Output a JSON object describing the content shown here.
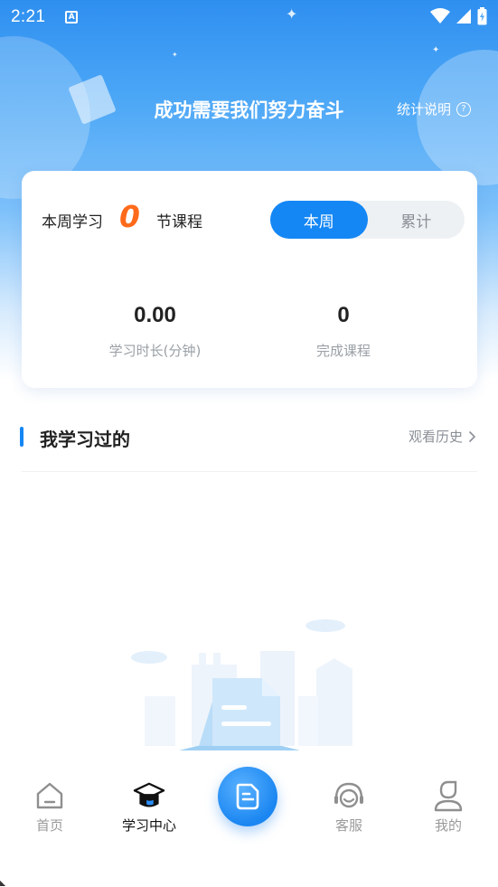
{
  "status_bar": {
    "time": "2:21",
    "indicator_letter": "A"
  },
  "header": {
    "motto": "成功需要我们努力奋斗",
    "stats_link": "统计说明",
    "help_glyph": "?"
  },
  "summary_card": {
    "week_prefix": "本周学习",
    "week_count": "0",
    "week_suffix": "节课程",
    "segments": [
      {
        "label": "本周",
        "active": true
      },
      {
        "label": "累计",
        "active": false
      }
    ],
    "metrics": [
      {
        "value": "0.00",
        "label": "学习时长(分钟)"
      },
      {
        "value": "0",
        "label": "完成课程"
      }
    ]
  },
  "section": {
    "title": "我学习过的",
    "history_link": "观看历史"
  },
  "bottom_nav": {
    "items": [
      {
        "label": "首页",
        "icon": "home-icon",
        "active": false
      },
      {
        "label": "学习中心",
        "icon": "graduation-cap-icon",
        "active": true
      },
      {
        "label": "",
        "icon": "document-icon",
        "active": false
      },
      {
        "label": "客服",
        "icon": "headset-icon",
        "active": false
      },
      {
        "label": "我的",
        "icon": "user-icon",
        "active": false
      }
    ]
  },
  "colors": {
    "accent": "#1487f5",
    "highlight": "#ff6a1a",
    "header_gradient_top": "#2f8ff0"
  }
}
